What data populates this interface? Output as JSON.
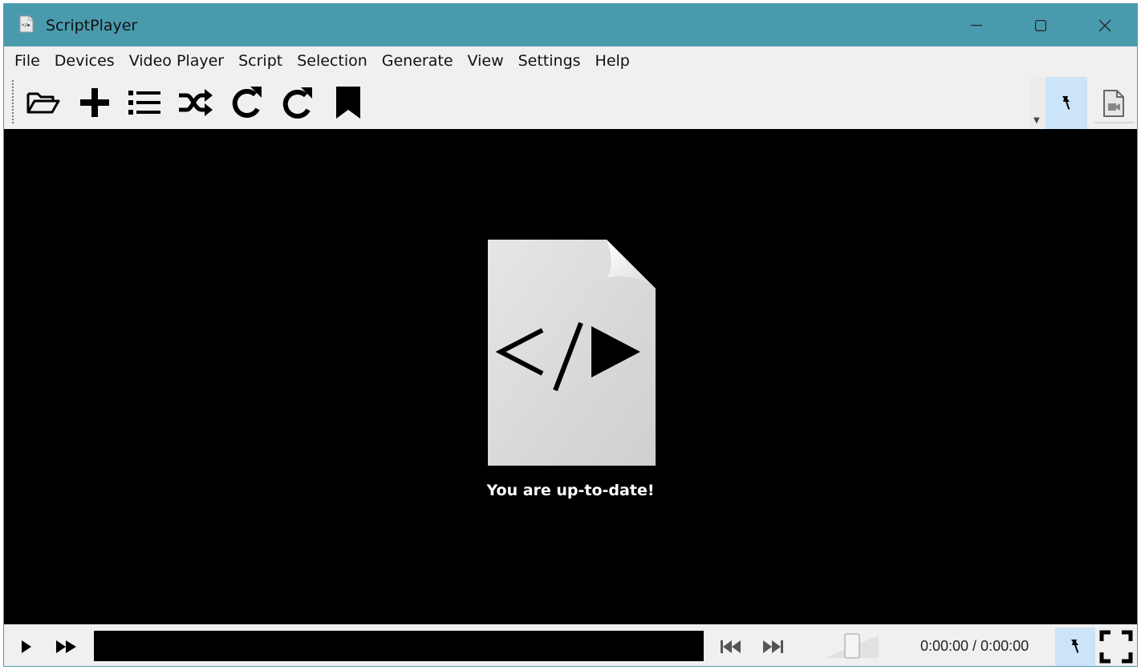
{
  "window": {
    "title": "ScriptPlayer",
    "accent_color": "#4a9aad"
  },
  "menu": {
    "items": [
      "File",
      "Devices",
      "Video Player",
      "Script",
      "Selection",
      "Generate",
      "View",
      "Settings",
      "Help"
    ]
  },
  "toolbar": {
    "icons": [
      "folder-open-icon",
      "plus-icon",
      "list-icon",
      "shuffle-icon",
      "rotate-right-icon",
      "redo-icon",
      "bookmark-icon"
    ],
    "right_icons": [
      "pin-icon",
      "video-file-icon"
    ]
  },
  "video": {
    "status_message": "You are up-to-date!"
  },
  "controls": {
    "time": "0:00:00 / 0:00:00",
    "pinned_color": "#cce4f7"
  }
}
